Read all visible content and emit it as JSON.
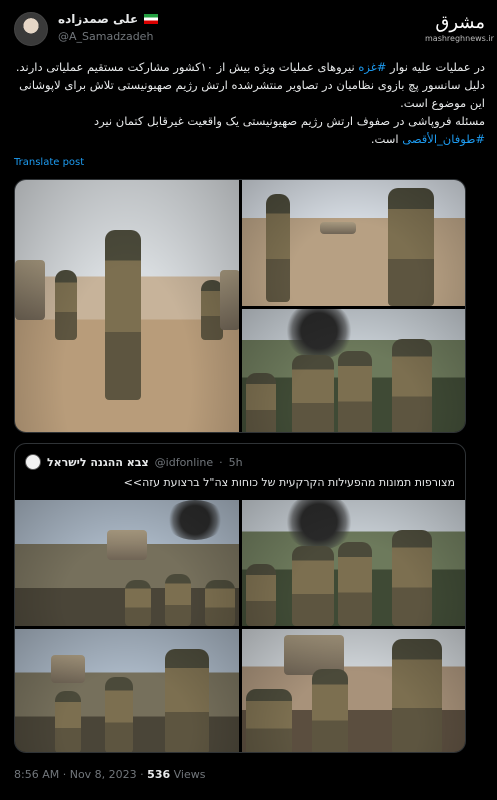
{
  "tweet": {
    "author_name": "علی صمدزاده",
    "author_handle": "@A_Samadzadeh",
    "logo_text": "مشرق",
    "logo_sub": "mashreghnews.ir",
    "body_line1_pre": "در عملیات علیه نوار ",
    "body_line1_hashtag": "#غزه",
    "body_line1_post": " نیروهای عملیات ویژه بیش از ۱۰کشور مشارکت مستقیم عملیاتی دارند.",
    "body_line2": "دلیل سانسور پچ بازوی نظامیان در تصاویر منتشرشده ارتش رژیم صهیونیستی تلاش برای لاپوشانی این موضوع است.",
    "body_line3_pre": "مسئله فروپاشی در صفوف ارتش رژیم صهیونیستی یک واقعیت غیرقابل کتمان نیرد ",
    "body_line3_hashtag": "#طوفان_الأقصى",
    "body_line3_post": " است.",
    "translate_label": "Translate post",
    "time": "8:56 AM",
    "date": "Nov 8, 2023",
    "views_count": "536",
    "views_label": "Views",
    "separator": "·"
  },
  "quoted": {
    "author_name": "צבא ההגנה לישראל",
    "author_handle": "@idfonline",
    "age": "5h",
    "text": "מצורפות תמונות מהפעילות הקרקעית של כוחות צה\"ל ברצועת עזה>>"
  },
  "colors": {
    "background": "#000000",
    "text": "#e7e9ea",
    "muted": "#71767b",
    "link": "#1d9bf0",
    "border": "#2f3336"
  }
}
